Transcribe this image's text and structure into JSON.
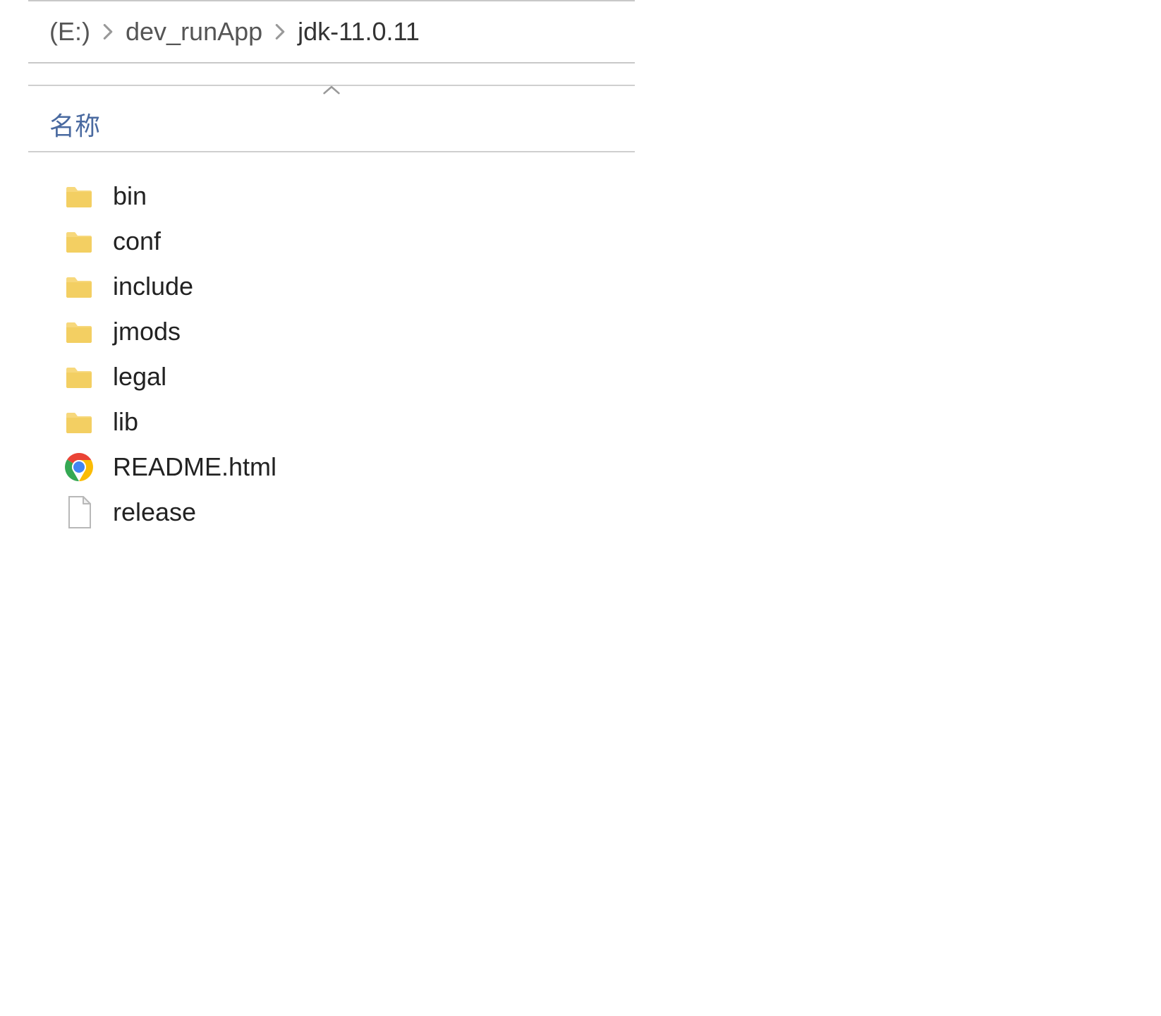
{
  "breadcrumb": {
    "items": [
      {
        "label": "(E:)"
      },
      {
        "label": "dev_runApp"
      },
      {
        "label": "jdk-11.0.11"
      }
    ]
  },
  "columns": {
    "name_header": "名称"
  },
  "files": [
    {
      "name": "bin",
      "icon": "folder"
    },
    {
      "name": "conf",
      "icon": "folder"
    },
    {
      "name": "include",
      "icon": "folder"
    },
    {
      "name": "jmods",
      "icon": "folder"
    },
    {
      "name": "legal",
      "icon": "folder"
    },
    {
      "name": "lib",
      "icon": "folder"
    },
    {
      "name": "README.html",
      "icon": "chrome"
    },
    {
      "name": "release",
      "icon": "file"
    }
  ]
}
